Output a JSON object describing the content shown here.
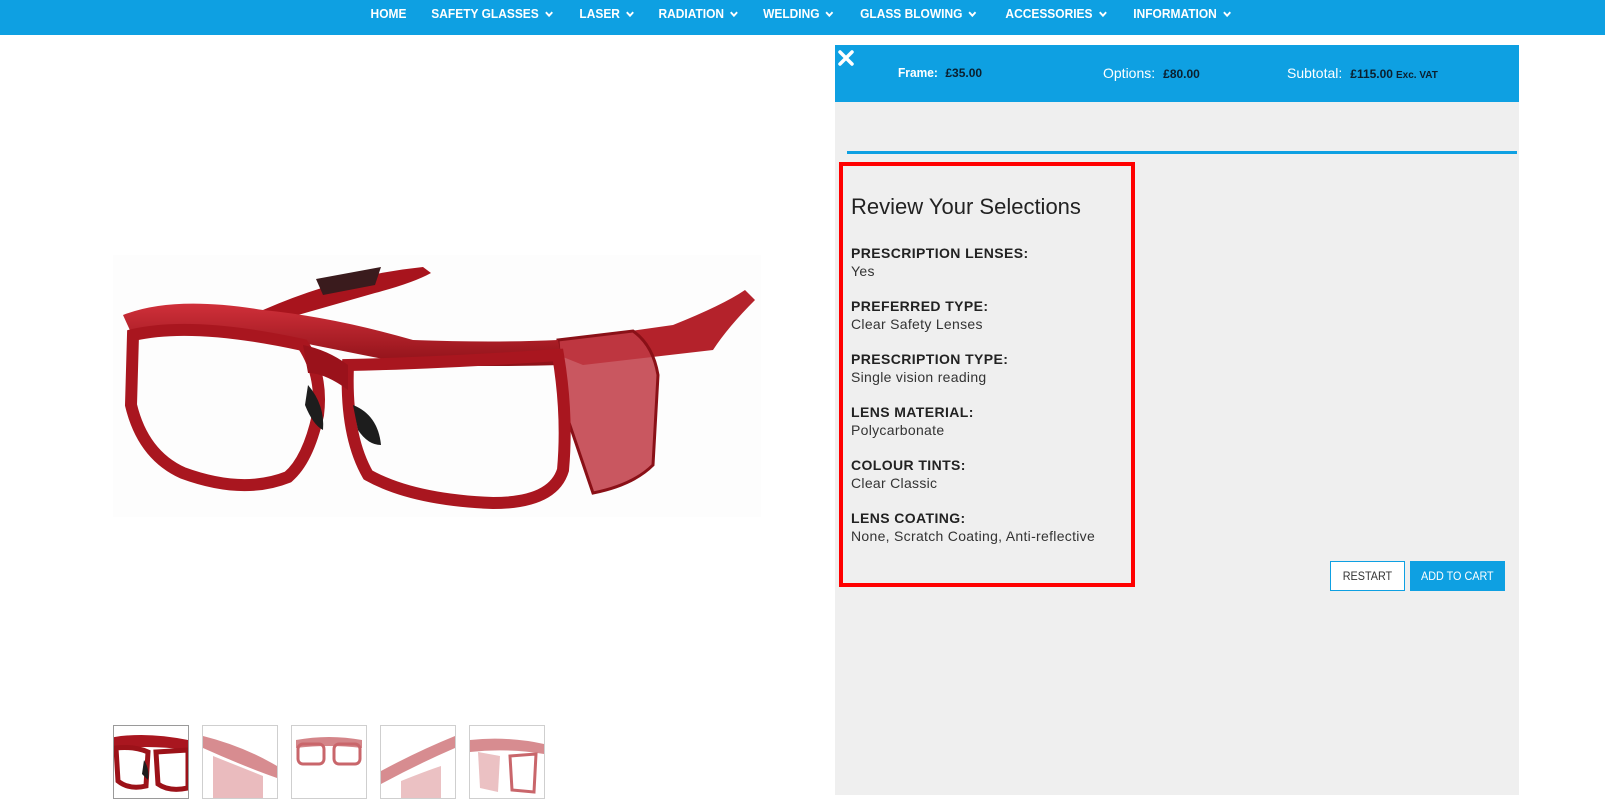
{
  "nav": {
    "items": [
      {
        "label": "HOME",
        "dropdown": false
      },
      {
        "label": "SAFETY GLASSES",
        "dropdown": true
      },
      {
        "label": "LASER",
        "dropdown": true
      },
      {
        "label": "RADIATION",
        "dropdown": true
      },
      {
        "label": "WELDING",
        "dropdown": true
      },
      {
        "label": "GLASS BLOWING",
        "dropdown": true
      },
      {
        "label": "ACCESSORIES",
        "dropdown": true
      },
      {
        "label": "INFORMATION",
        "dropdown": true
      }
    ]
  },
  "price_bar": {
    "frame_label": "Frame:",
    "frame_value": "£35.00",
    "options_label": "Options:",
    "options_value": "£80.00",
    "subtotal_label": "Subtotal:",
    "subtotal_value": "£115.00",
    "vat_note": "Exc. VAT"
  },
  "review": {
    "title": "Review Your Selections",
    "selections": [
      {
        "label": "PRESCRIPTION LENSES:",
        "value": "Yes"
      },
      {
        "label": "PREFERRED TYPE:",
        "value": "Clear Safety Lenses"
      },
      {
        "label": "PRESCRIPTION TYPE:",
        "value": "Single vision reading"
      },
      {
        "label": "LENS MATERIAL:",
        "value": "Polycarbonate"
      },
      {
        "label": "COLOUR TINTS:",
        "value": "Clear Classic"
      },
      {
        "label": "LENS COATING:",
        "value": "None, Scratch Coating, Anti-reflective"
      }
    ]
  },
  "buttons": {
    "restart": "RESTART",
    "add_to_cart": "ADD TO CART"
  },
  "colors": {
    "brand_blue": "#0ea0e2",
    "frame_red": "#b01a22",
    "highlight_red": "#ff0000"
  },
  "icons": {
    "close": "close-x-icon",
    "dropdown": "chevron-down-icon"
  },
  "thumbnails": 5
}
